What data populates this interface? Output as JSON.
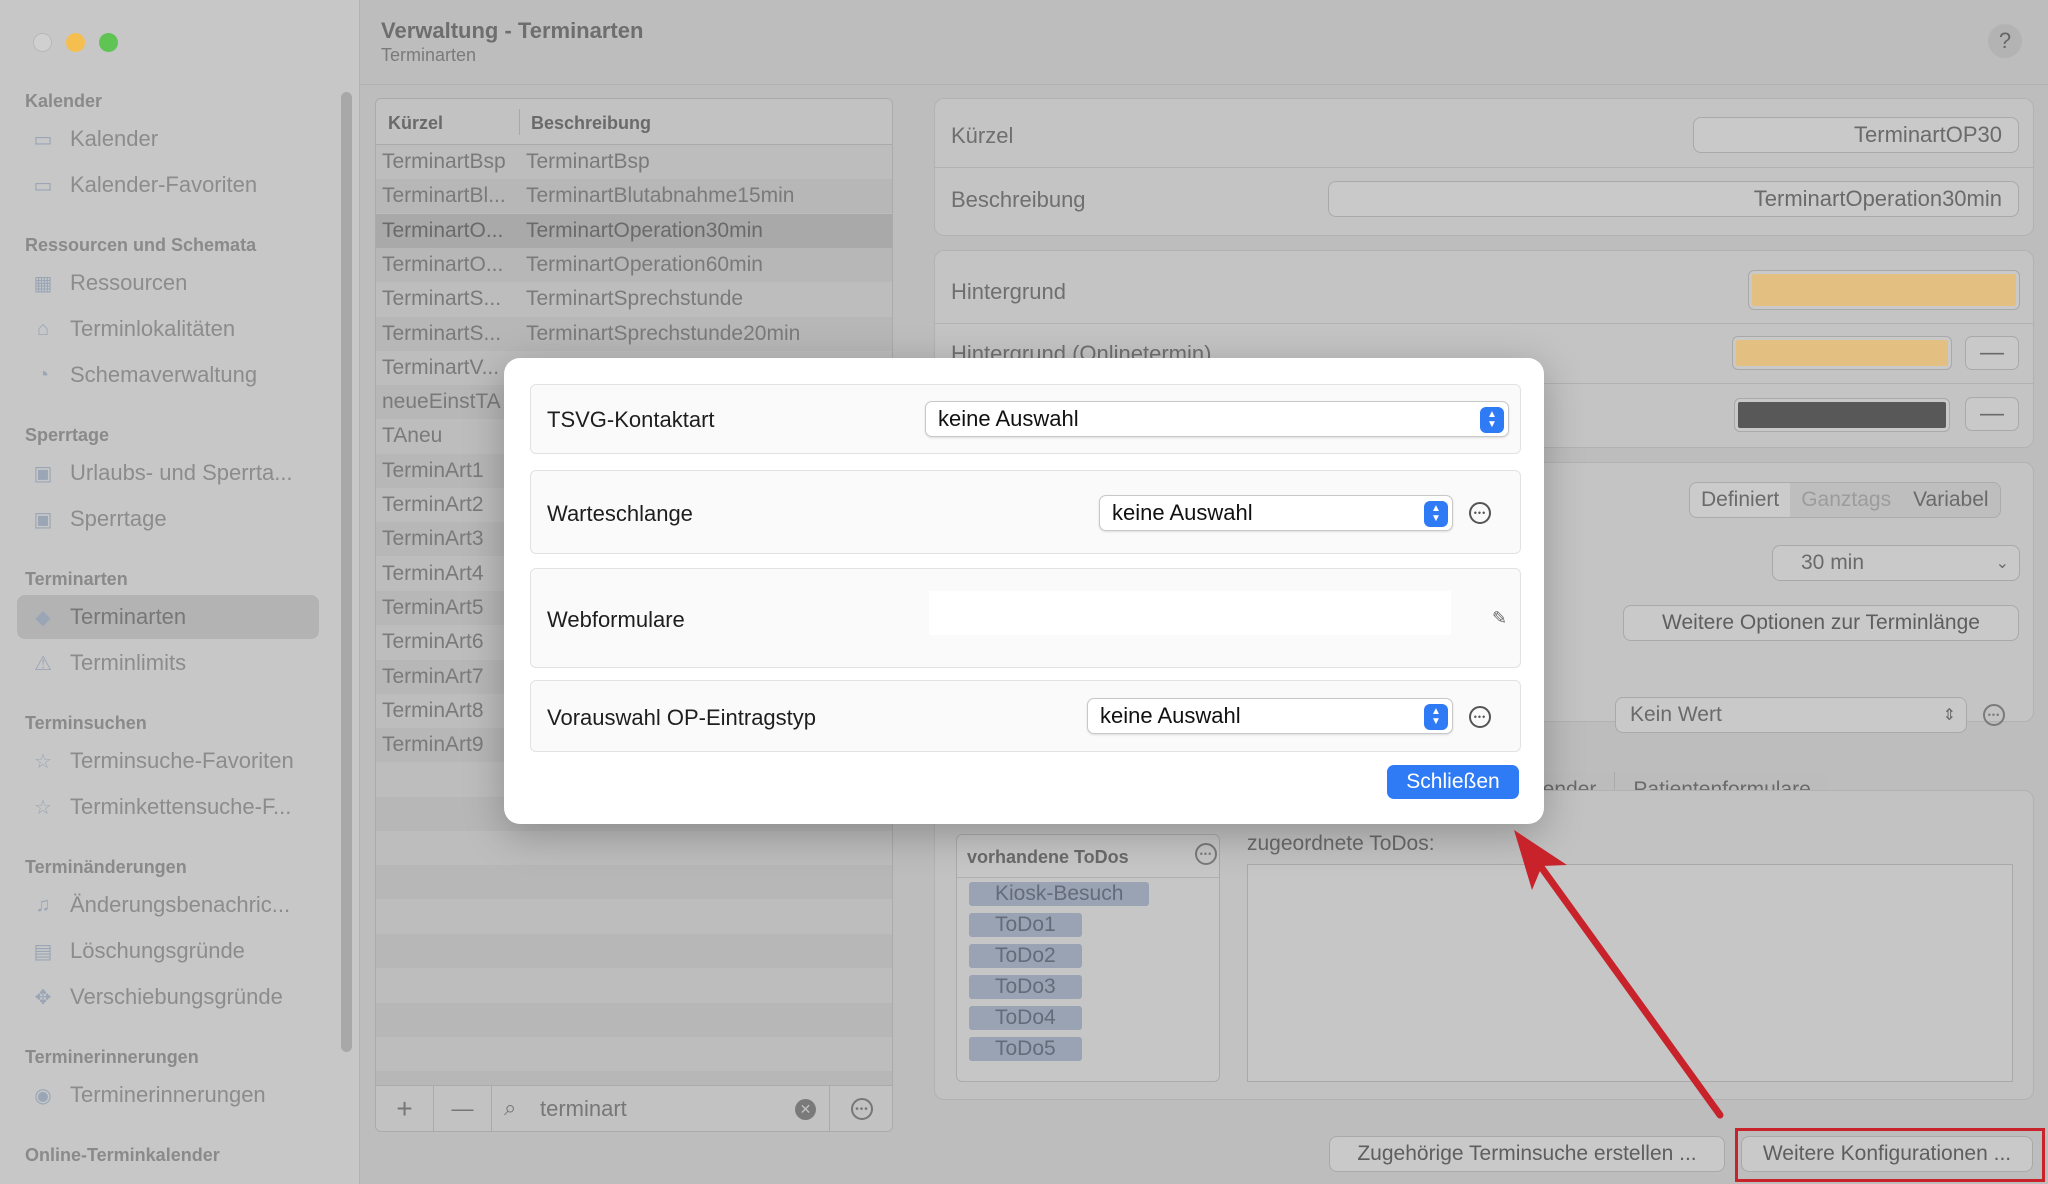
{
  "window": {
    "title": "Verwaltung - Terminarten",
    "subtitle": "Terminarten",
    "help": "?"
  },
  "colors": {
    "accent": "#2f7bf6",
    "annotation": "#c8232b",
    "swatch_bg": "#e3c081",
    "swatch_dark": "#585858"
  },
  "sidebar": {
    "sections": [
      {
        "title": "Kalender",
        "items": [
          {
            "label": "Kalender",
            "icon": "calendar-icon"
          },
          {
            "label": "Kalender-Favoriten",
            "icon": "calendar-icon"
          }
        ]
      },
      {
        "title": "Ressourcen und Schemata",
        "items": [
          {
            "label": "Ressourcen",
            "icon": "grid-icon"
          },
          {
            "label": "Terminlokalitäten",
            "icon": "house-icon"
          },
          {
            "label": "Schemaverwaltung",
            "icon": "clock-icon"
          }
        ]
      },
      {
        "title": "Sperrtage",
        "items": [
          {
            "label": "Urlaubs- und Sperrta...",
            "icon": "calendar-block-icon"
          },
          {
            "label": "Sperrtage",
            "icon": "calendar-block-icon"
          }
        ]
      },
      {
        "title": "Terminarten",
        "items": [
          {
            "label": "Terminarten",
            "icon": "shapes-icon"
          },
          {
            "label": "Terminlimits",
            "icon": "warning-icon"
          }
        ]
      },
      {
        "title": "Terminsuchen",
        "items": [
          {
            "label": "Terminsuche-Favoriten",
            "icon": "star-icon"
          },
          {
            "label": "Terminkettensuche-F...",
            "icon": "star-icon"
          }
        ]
      },
      {
        "title": "Terminänderungen",
        "items": [
          {
            "label": "Änderungsbenachric...",
            "icon": "bell-icon"
          },
          {
            "label": "Löschungsgründe",
            "icon": "trash-icon"
          },
          {
            "label": "Verschiebungsgründe",
            "icon": "move-icon"
          }
        ]
      },
      {
        "title": "Terminerinnerungen",
        "items": [
          {
            "label": "Terminerinnerungen",
            "icon": "reminder-icon"
          }
        ]
      },
      {
        "title": "Online-Terminkalender",
        "items": []
      }
    ]
  },
  "list": {
    "headers": {
      "short": "Kürzel",
      "desc": "Beschreibung"
    },
    "rows": [
      {
        "short": "TerminartBsp",
        "desc": "TerminartBsp"
      },
      {
        "short": "TerminartBl...",
        "desc": "TerminartBlutabnahme15min"
      },
      {
        "short": "TerminartO...",
        "desc": "TerminartOperation30min"
      },
      {
        "short": "TerminartO...",
        "desc": "TerminartOperation60min"
      },
      {
        "short": "TerminartS...",
        "desc": "TerminartSprechstunde"
      },
      {
        "short": "TerminartS...",
        "desc": "TerminartSprechstunde20min"
      },
      {
        "short": "TerminartV...",
        "desc": ""
      },
      {
        "short": "neueEinstTA",
        "desc": ""
      },
      {
        "short": "TAneu",
        "desc": ""
      },
      {
        "short": "TerminArt1",
        "desc": ""
      },
      {
        "short": "TerminArt2",
        "desc": ""
      },
      {
        "short": "TerminArt3",
        "desc": ""
      },
      {
        "short": "TerminArt4",
        "desc": ""
      },
      {
        "short": "TerminArt5",
        "desc": ""
      },
      {
        "short": "TerminArt6",
        "desc": ""
      },
      {
        "short": "TerminArt7",
        "desc": ""
      },
      {
        "short": "TerminArt8",
        "desc": ""
      },
      {
        "short": "TerminArt9",
        "desc": ""
      }
    ],
    "search_value": "terminart",
    "add": "+",
    "remove": "—"
  },
  "detail": {
    "kuerzel_label": "Kürzel",
    "kuerzel_value": "TerminartOP30",
    "beschreibung_label": "Beschreibung",
    "beschreibung_value": "TerminartOperation30min",
    "hintergrund_label": "Hintergrund",
    "hintergrund_online_label": "Hintergrund (Onlinetermin)",
    "minus": "—",
    "seg": [
      "Definiert",
      "Ganztags",
      "Variabel"
    ],
    "duration": "30 min",
    "more_duration_btn": "Weitere Optionen zur Terminlänge",
    "kein_wert": "Kein Wert",
    "tabs": [
      "lender",
      "Patientenformulare"
    ],
    "todos_header": "vorhandene ToDos",
    "todos": [
      "Kiosk-Besuch",
      "ToDo1",
      "ToDo2",
      "ToDo3",
      "ToDo4",
      "ToDo5"
    ],
    "assigned_label": "zugeordnete ToDos:",
    "btn_search": "Zugehörige Terminsuche erstellen ...",
    "btn_more_config": "Weitere Konfigurationen ..."
  },
  "modal": {
    "tsvg_label": "TSVG-Kontaktart",
    "tsvg_value": "keine Auswahl",
    "queue_label": "Warteschlange",
    "queue_value": "keine Auswahl",
    "web_label": "Webformulare",
    "op_label": "Vorauswahl OP-Eintragstyp",
    "op_value": "keine Auswahl",
    "close": "Schließen"
  }
}
